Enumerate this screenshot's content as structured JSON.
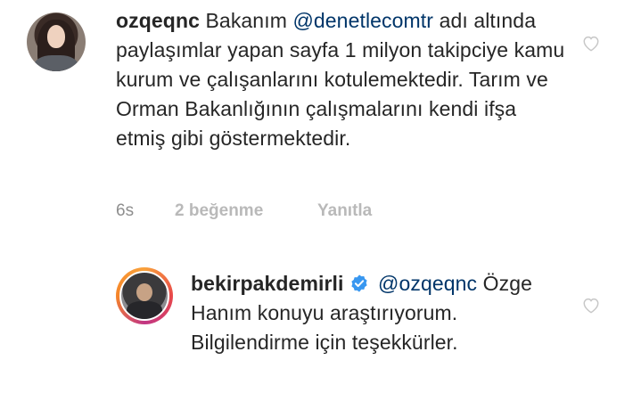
{
  "comments": [
    {
      "username": "ozqeqnc",
      "text_before_mention": "Bakanım",
      "mention": "@denetlecomtr",
      "text_after_mention": "adı altında paylaşımlar yapan sayfa 1 milyon takipciye kamu kurum ve çalışanlarını kotulemektedir. Tarım ve Orman Bakanlığının çalışmalarını kendi ifşa etmiş gibi göstermektedir.",
      "time": "6s",
      "likes": "2 beğenme",
      "reply": "Yanıtla",
      "avatar_icon": "user-avatar-photo",
      "like_icon": "heart-outline-icon"
    },
    {
      "username": "bekirpakdemirli",
      "verified": true,
      "mention": "@ozqeqnc",
      "text_after_mention": "Özge Hanım konuyu araştırıyorum. Bilgilendirme için teşekkürler.",
      "avatar_icon": "story-ring-avatar-photo",
      "like_icon": "heart-outline-icon"
    }
  ],
  "colors": {
    "text": "#262626",
    "mention": "#003569",
    "meta": "#8e8e8e",
    "meta_light": "#b9b9b9",
    "verified_badge": "#3897f0"
  }
}
